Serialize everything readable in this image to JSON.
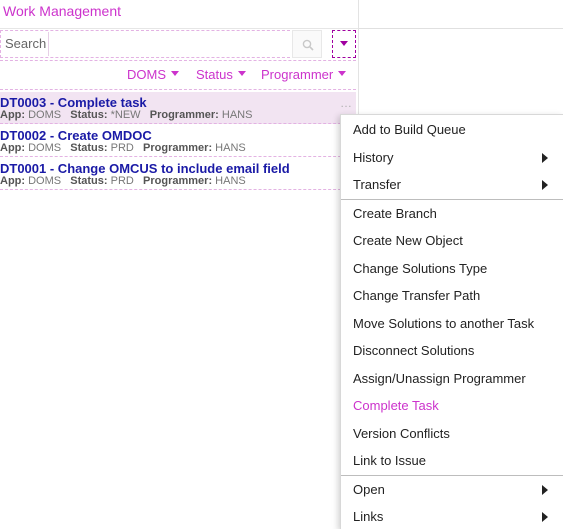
{
  "header": {
    "title": "Work Management"
  },
  "search": {
    "placeholder": "Search"
  },
  "filters": [
    {
      "label": "DOMS"
    },
    {
      "label": "Status"
    },
    {
      "label": "Programmer"
    }
  ],
  "tasks": [
    {
      "title": "DT0003 - Complete task",
      "app_label": "App:",
      "app": "DOMS",
      "status_label": "Status:",
      "status": "*NEW",
      "programmer_label": "Programmer:",
      "programmer": "HANS",
      "more": "…"
    },
    {
      "title": "DT0002 - Create OMDOC",
      "app_label": "App:",
      "app": "DOMS",
      "status_label": "Status:",
      "status": "PRD",
      "programmer_label": "Programmer:",
      "programmer": "HANS"
    },
    {
      "title": "DT0001 - Change OMCUS to include email field",
      "app_label": "App:",
      "app": "DOMS",
      "status_label": "Status:",
      "status": "PRD",
      "programmer_label": "Programmer:",
      "programmer": "HANS"
    }
  ],
  "context_menu": {
    "items": [
      {
        "label": "Add to Build Queue"
      },
      {
        "label": "History"
      },
      {
        "label": "Transfer"
      },
      {
        "label": "Create Branch"
      },
      {
        "label": "Create New Object"
      },
      {
        "label": "Change Solutions Type"
      },
      {
        "label": "Change Transfer Path"
      },
      {
        "label": "Move Solutions to another Task"
      },
      {
        "label": "Disconnect Solutions"
      },
      {
        "label": "Assign/Unassign Programmer"
      },
      {
        "label": "Complete Task"
      },
      {
        "label": "Version Conflicts"
      },
      {
        "label": "Link to Issue"
      },
      {
        "label": "Open"
      },
      {
        "label": "Links"
      }
    ]
  },
  "colors": {
    "accent": "#cc33cc",
    "task_title": "#1a1aa6",
    "selected_row": "#f2e4f2"
  },
  "icons": {
    "search": "search-icon",
    "dropdown": "chevron-down-icon",
    "submenu": "chevron-right-icon"
  }
}
